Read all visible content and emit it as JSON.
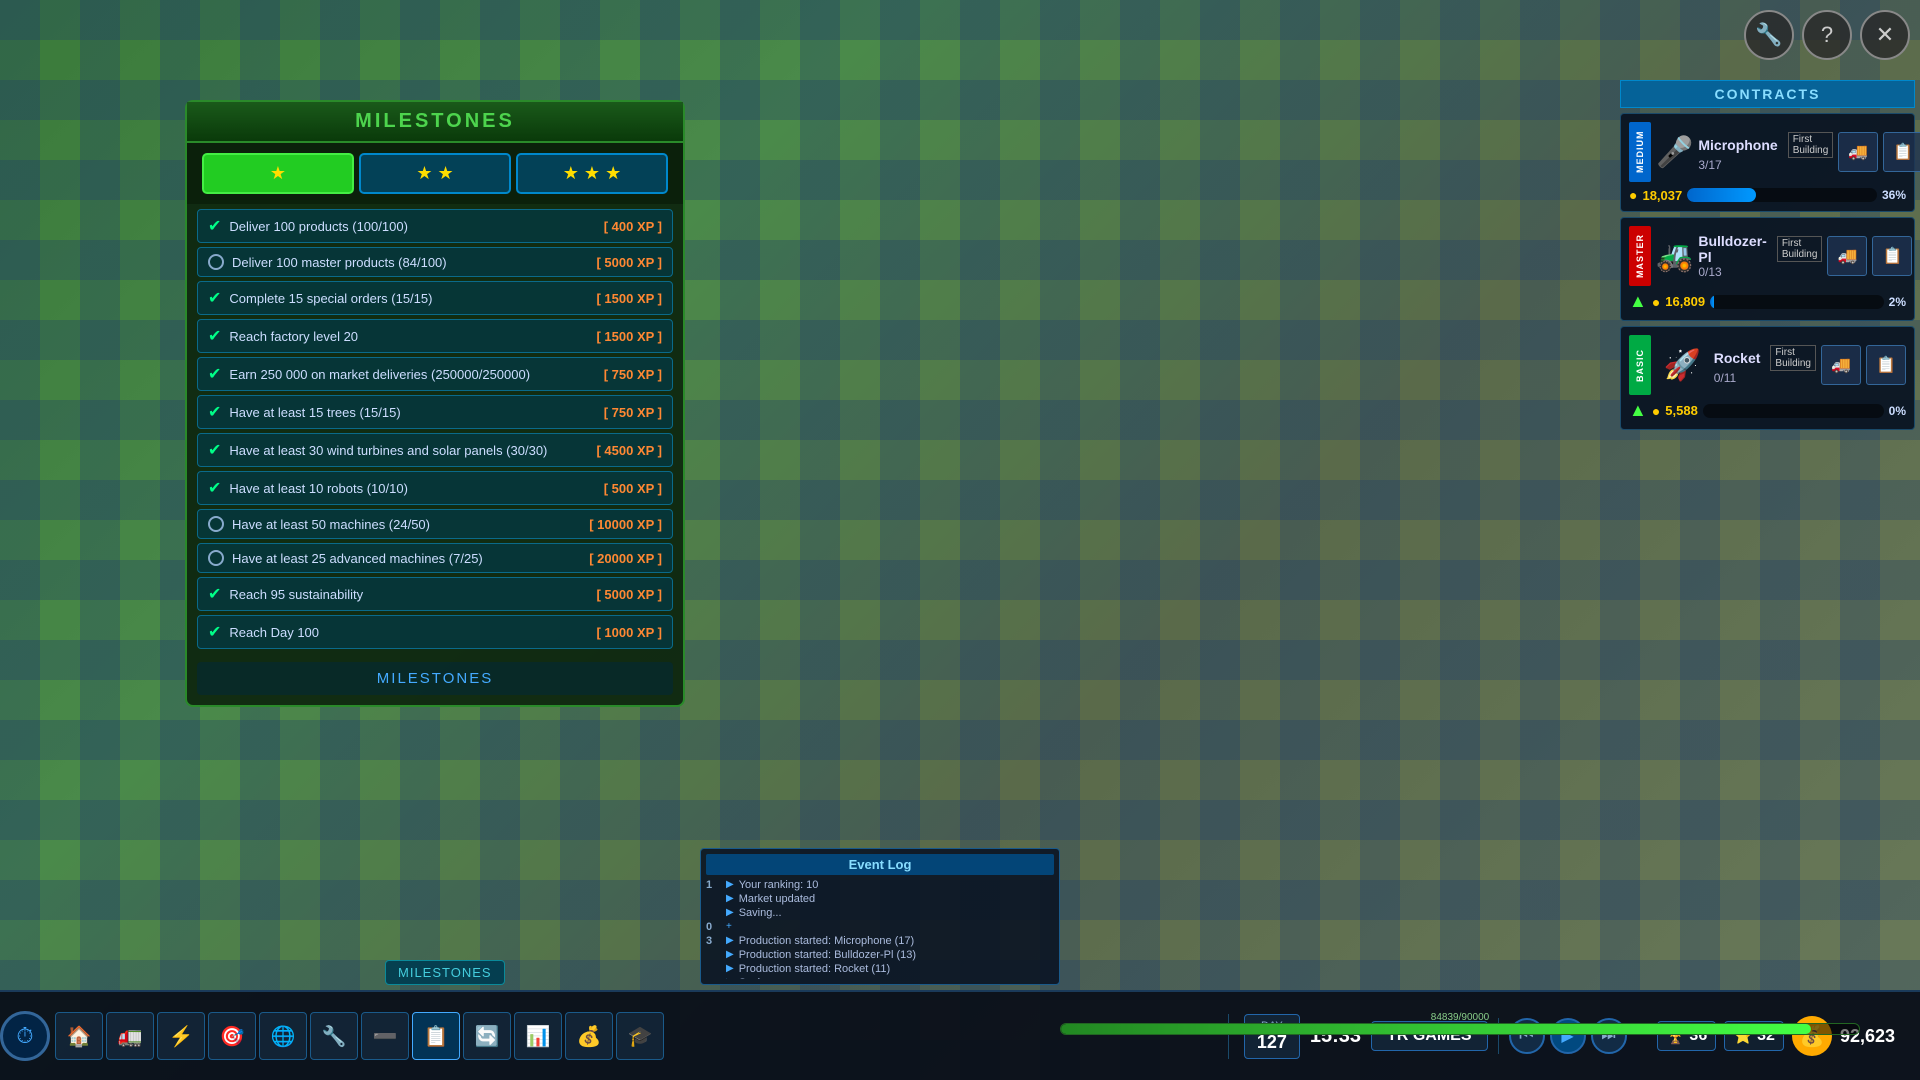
{
  "topIcons": {
    "tools": "🔧",
    "help": "?",
    "close": "✕"
  },
  "milestones": {
    "title": "MILESTONES",
    "footer": "MILESTONES",
    "tabs": [
      {
        "label": "★",
        "active": true
      },
      {
        "label": "★★",
        "active": false
      },
      {
        "label": "★★★",
        "active": false
      }
    ],
    "items": [
      {
        "completed": true,
        "text": "Deliver 100 products (100/100)",
        "xp": "[ 400 XP ]"
      },
      {
        "completed": false,
        "text": "Deliver 100 master products (84/100)",
        "xp": "[ 5000 XP ]"
      },
      {
        "completed": true,
        "text": "Complete 15 special orders (15/15)",
        "xp": "[ 1500 XP ]"
      },
      {
        "completed": true,
        "text": "Reach factory level 20",
        "xp": "[ 1500 XP ]"
      },
      {
        "completed": true,
        "text": "Earn 250 000 on market deliveries (250000/250000)",
        "xp": "[ 750 XP ]"
      },
      {
        "completed": true,
        "text": "Have at least 15 trees (15/15)",
        "xp": "[ 750 XP ]"
      },
      {
        "completed": true,
        "text": "Have at least 30 wind turbines and solar panels (30/30)",
        "xp": "[ 4500 XP ]"
      },
      {
        "completed": true,
        "text": "Have at least 10 robots (10/10)",
        "xp": "[ 500 XP ]"
      },
      {
        "completed": false,
        "text": "Have at least 50 machines (24/50)",
        "xp": "[ 10000 XP ]"
      },
      {
        "completed": false,
        "text": "Have at least 25 advanced machines (7/25)",
        "xp": "[ 20000 XP ]"
      },
      {
        "completed": true,
        "text": "Reach 95 sustainability",
        "xp": "[ 5000 XP ]"
      },
      {
        "completed": true,
        "text": "Reach Day 100",
        "xp": "[ 1000 XP ]"
      }
    ]
  },
  "contracts": {
    "title": "CONTRACTS",
    "items": [
      {
        "difficulty": "MEDIUM",
        "difficultyClass": "medium",
        "name": "Microphone",
        "firstBuilding": "First Building",
        "count": "3/17",
        "price": "18,037",
        "progress": 36,
        "progressLabel": "36%",
        "productEmoji": "🎤"
      },
      {
        "difficulty": "MASTER",
        "difficultyClass": "master",
        "name": "Bulldozer-Pl",
        "firstBuilding": "First Building",
        "count": "0/13",
        "price": "16,809",
        "progress": 2,
        "progressLabel": "2%",
        "productEmoji": "🚜"
      },
      {
        "difficulty": "BASIC",
        "difficultyClass": "basic",
        "name": "Rocket",
        "firstBuilding": "First Building",
        "count": "0/11",
        "price": "5,588",
        "progress": 0,
        "progressLabel": "0%",
        "productEmoji": "🚀"
      }
    ]
  },
  "eventLog": {
    "title": "Event Log",
    "entries": [
      {
        "num": "1",
        "icon": "▶",
        "text": "Your ranking: 10"
      },
      {
        "num": "",
        "icon": "▶",
        "text": "Market updated"
      },
      {
        "num": "",
        "icon": "▶",
        "text": "Saving..."
      },
      {
        "num": "0",
        "icon": "+",
        "text": ""
      },
      {
        "num": "3",
        "icon": "▶",
        "text": "Production started: Microphone (17)"
      },
      {
        "num": "",
        "icon": "▶",
        "text": "Production started: Bulldozer-Pl (13)"
      },
      {
        "num": "",
        "icon": "▶",
        "text": "Production started: Rocket (11)"
      },
      {
        "num": "",
        "icon": "▶",
        "text": "Saving..."
      }
    ]
  },
  "hud": {
    "day_label": "DAY",
    "day_value": "127",
    "time": "15:33",
    "company": "TR GAMES",
    "xp_level": "36",
    "xp_progress": "84839",
    "xp_total": "90000",
    "xp_bar_pct": 94,
    "coins": "92,623",
    "stars": "32"
  },
  "toolbar": {
    "buttons": [
      "🏠",
      "🚛",
      "⚡",
      "🎯",
      "🌐",
      "🔧",
      "➖",
      "📋",
      "🔄",
      "📊",
      "💰",
      "🎓"
    ]
  }
}
